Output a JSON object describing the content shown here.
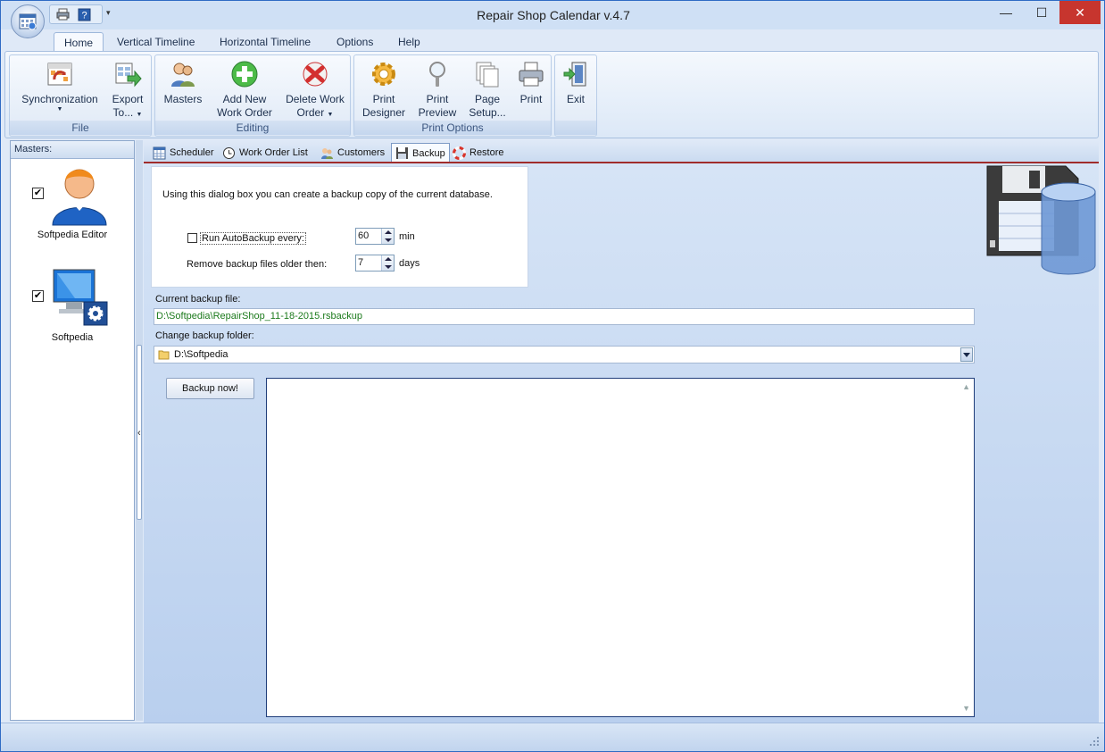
{
  "window": {
    "title": "Repair Shop Calendar v.4.7",
    "minimize": "—",
    "maximize": "☐",
    "close": "✕"
  },
  "qat": {
    "dropdown": "▾"
  },
  "ribbon_tabs": [
    "Home",
    "Vertical Timeline",
    "Horizontal Timeline",
    "Options",
    "Help"
  ],
  "ribbon": {
    "file": {
      "label": "File",
      "synchronization": "Synchronization",
      "export_l1": "Export",
      "export_l2": "To...",
      "arrow": "▼"
    },
    "editing": {
      "label": "Editing",
      "masters": "Masters",
      "add_l1": "Add New",
      "add_l2": "Work Order",
      "delete_l1": "Delete Work",
      "delete_l2": "Order",
      "arrow": "▼"
    },
    "print_options": {
      "label": "Print Options",
      "designer_l1": "Print",
      "designer_l2": "Designer",
      "preview_l1": "Print",
      "preview_l2": "Preview",
      "setup_l1": "Page",
      "setup_l2": "Setup...",
      "print": "Print"
    },
    "exit": {
      "label": "Exit"
    }
  },
  "masters": {
    "header": "Masters:",
    "items": [
      {
        "name": "Softpedia Editor",
        "checked": "✔"
      },
      {
        "name": "Softpedia",
        "checked": "✔"
      }
    ]
  },
  "splitter": {
    "arrow": "‹"
  },
  "content_tabs": [
    "Scheduler",
    "Work Order List",
    "Customers",
    "Backup",
    "Restore"
  ],
  "backup": {
    "intro": "Using this dialog box you can create a backup copy of the current database.",
    "autobackup_label": "Run AutoBackup every:",
    "autobackup_value": "60",
    "autobackup_unit": "min",
    "remove_label": "Remove backup files older then:",
    "remove_value": "7",
    "remove_unit": "days",
    "current_file_label": "Current backup file:",
    "current_file_value": "D:\\Softpedia\\RepairShop_11-18-2015.rsbackup",
    "change_folder_label": "Change backup folder:",
    "folder_value": "D:\\Softpedia",
    "backup_button": "Backup now!"
  },
  "scroll": {
    "up": "▲",
    "down": "▼"
  },
  "colors": {
    "accent": "#2f6bc4",
    "file_path": "#1c7a1c",
    "tab_underline": "#a02c2c",
    "close": "#c7352e"
  }
}
